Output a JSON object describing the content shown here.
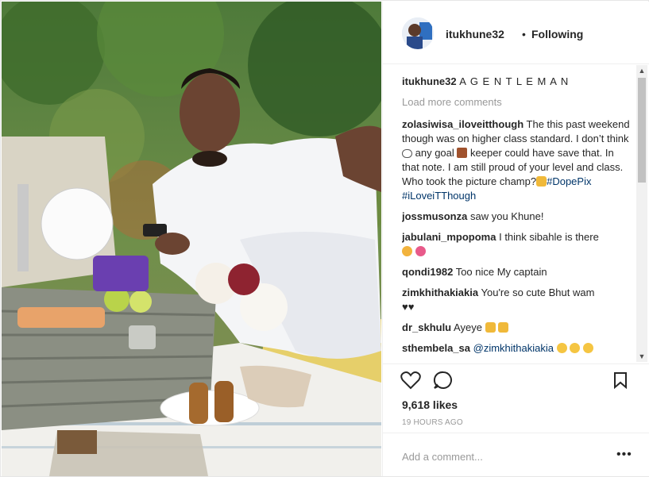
{
  "header": {
    "username": "itukhune32",
    "dot": "•",
    "follow_label": "Following"
  },
  "caption": {
    "username": "itukhune32",
    "text": "A G E N T L E M A N"
  },
  "load_more": "Load more comments",
  "comments": [
    {
      "user": "zolasiwisa_iloveitthough",
      "text_a": "The this past weekend though was on higher class standard. I don’t think",
      "text_b": "any goal",
      "text_c": "keeper could have save that. In that note. I am still proud of your level and class. Who took the picture champ?",
      "tag1": "#DopePix",
      "tag2": "#iLoveiTThough"
    },
    {
      "user": "jossmusonza",
      "text": "saw you Khune!"
    },
    {
      "user": "jabulani_mpopoma",
      "text": "I think sibahle is there"
    },
    {
      "user": "qondi1982",
      "text": "Too nice My captain"
    },
    {
      "user": "zimkhithakiakia",
      "text": "You're so cute Bhut wam"
    },
    {
      "user": "dr_skhulu",
      "text": "Ayeye"
    },
    {
      "user": "sthembela_sa",
      "mention": "@zimkhithakiakia"
    }
  ],
  "icons": [
    "heart-icon",
    "comment-bubble-icon",
    "bookmark-icon",
    "more-options-icon"
  ],
  "likes": "9,618 likes",
  "time_ago": "19 HOURS AGO",
  "add_comment_placeholder": "Add a comment...",
  "more_glyph": "•••",
  "colors": {
    "link": "#003569",
    "muted": "#999999",
    "text": "#262626"
  }
}
